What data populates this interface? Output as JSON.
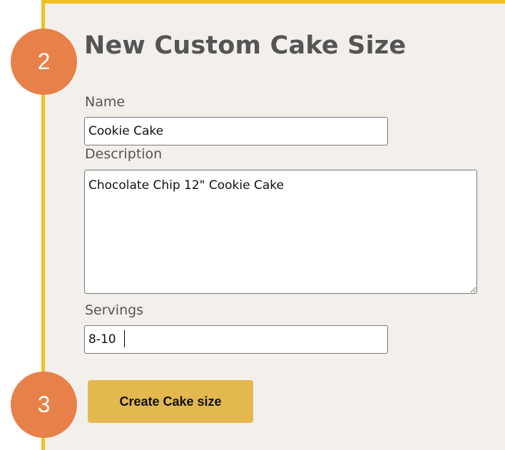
{
  "form": {
    "title": "New Custom Cake Size",
    "name_label": "Name",
    "name_value": "Cookie Cake",
    "description_label": "Description",
    "description_value": "Chocolate Chip 12\" Cookie Cake",
    "servings_label": "Servings",
    "servings_value": "8-10",
    "submit_label": "Create Cake size"
  },
  "annotations": {
    "step_2": "2",
    "step_3": "3"
  },
  "colors": {
    "panel_background": "#f3f0ec",
    "panel_border": "#f2c01e",
    "button_background": "#e2b84f",
    "badge_background": "#e8804a",
    "title_text": "#555555"
  }
}
